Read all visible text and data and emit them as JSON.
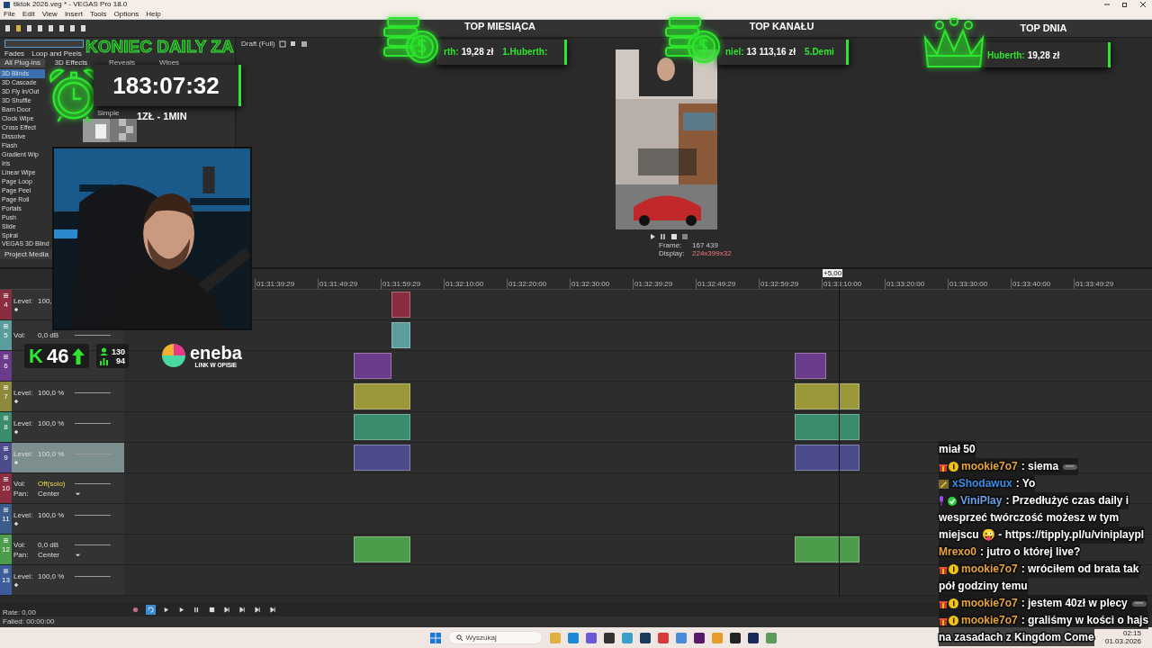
{
  "window": {
    "title": "tiktok 2026.veg * - VEGAS Pro 18.0"
  },
  "menu": [
    "File",
    "Edit",
    "View",
    "Insert",
    "Tools",
    "Options",
    "Help"
  ],
  "preview_toolbar": {
    "quality": "Draft (Full)"
  },
  "transitions": {
    "tabs_row1": [
      {
        "label": "Fades",
        "selected": false
      },
      {
        "label": "Loop and Peels",
        "selected": false
      }
    ],
    "tabs_row2": [
      {
        "label": "All Plug-ins",
        "selected": true
      },
      {
        "label": "3D Effects",
        "selected": false
      },
      {
        "label": "Reveals",
        "selected": false
      },
      {
        "label": "Wipes",
        "selected": false
      }
    ],
    "items": [
      {
        "label": "3D Blinds",
        "selected": true
      },
      {
        "label": "3D Cascade",
        "selected": false
      },
      {
        "label": "3D Fly In/Out",
        "selected": false
      },
      {
        "label": "3D Shuffle",
        "selected": false
      },
      {
        "label": "Barn Door",
        "selected": false
      },
      {
        "label": "Clock Wipe",
        "selected": false
      },
      {
        "label": "Cross Effect",
        "selected": false
      },
      {
        "label": "Dissolve",
        "selected": false
      },
      {
        "label": "Flash",
        "selected": false
      },
      {
        "label": "Gradient Wip",
        "selected": false
      },
      {
        "label": "Iris",
        "selected": false
      },
      {
        "label": "Linear Wipe",
        "selected": false
      },
      {
        "label": "Page Loop",
        "selected": false
      },
      {
        "label": "Page Peel",
        "selected": false
      },
      {
        "label": "Page Roll",
        "selected": false
      },
      {
        "label": "Portals",
        "selected": false
      },
      {
        "label": "Push",
        "selected": false
      },
      {
        "label": "Slide",
        "selected": false
      },
      {
        "label": "Spiral",
        "selected": false
      }
    ],
    "preview_label": "Simple",
    "selection": "VEGAS 3D Blind",
    "media_tab": "Project Media"
  },
  "preview": {
    "frame_label": "Frame:",
    "frame": "167 439",
    "display_label": "Display:",
    "display": "224x399x32"
  },
  "timeline": {
    "marker": "+5,00",
    "ruler": [
      "01:31:39:29",
      "01:31:49:29",
      "01:31:59:29",
      "01:32:10:00",
      "01:32:20:00",
      "01:32:30:00",
      "01:32:39:29",
      "01:32:49:29",
      "01:32:59:29",
      "01:33:10:00",
      "01:33:20:00",
      "01:33:30:00",
      "01:33:40:00",
      "01:33:49:29"
    ],
    "tracks": [
      {
        "number": "4",
        "kind": "video",
        "color": "#8a2d40",
        "selected": false,
        "lines": [
          {
            "label": "Level:",
            "value": "100,"
          }
        ]
      },
      {
        "number": "5",
        "kind": "audio",
        "color": "#5b9c9c",
        "selected": false,
        "lines": [
          {
            "label": "Vol:",
            "value": "0,0 dB",
            "solo": false
          }
        ]
      },
      {
        "number": "6",
        "kind": "video",
        "color": "#6c3c8c",
        "selected": false
      },
      {
        "number": "7",
        "kind": "video",
        "color": "#8c8a3a",
        "selected": false,
        "lines": [
          {
            "label": "Level:",
            "value": "100,0 %"
          }
        ]
      },
      {
        "number": "8",
        "kind": "video",
        "color": "#3a8c6c",
        "selected": false,
        "lines": [
          {
            "label": "Level:",
            "value": "100,0 %"
          }
        ]
      },
      {
        "number": "9",
        "kind": "video",
        "color": "#4c4c8c",
        "selected": true,
        "lines": [
          {
            "label": "Level:",
            "value": "100,0 %"
          }
        ]
      },
      {
        "number": "10",
        "kind": "audio",
        "color": "#8c2d40",
        "selected": false,
        "lines": [
          {
            "label": "Vol:",
            "value": "Off(solo)",
            "solo": true
          },
          {
            "label": "Pan:",
            "value": "Center",
            "solo": false
          }
        ]
      },
      {
        "number": "11",
        "kind": "video",
        "color": "#3c5c8c",
        "selected": false,
        "lines": [
          {
            "label": "Level:",
            "value": "100,0 %"
          }
        ]
      },
      {
        "number": "12",
        "kind": "audio",
        "color": "#4c9c4c",
        "selected": false,
        "lines": [
          {
            "label": "Vol:",
            "value": "0,0 dB",
            "solo": false
          },
          {
            "label": "Pan:",
            "value": "Center",
            "solo": false
          }
        ]
      },
      {
        "number": "13",
        "kind": "video",
        "color": "#3c5c9c",
        "selected": false,
        "lines": [
          {
            "label": "Level:",
            "value": "100,0 %"
          }
        ]
      }
    ]
  },
  "transport": {
    "loop_on": true
  },
  "status": {
    "rate": "Rate: 0,00",
    "failed": "Failed: 00:00:00"
  },
  "taskbar": {
    "search_placeholder": "Wyszukaj",
    "time": "02:15",
    "date": "01.03.2026"
  },
  "overlay": {
    "timer": {
      "title": "KONIEC DAILY ZA",
      "time": "183:07:32",
      "rate": "1ZŁ - 1MIN"
    },
    "leaderboards": [
      {
        "title": "TOP MIESIĄCA",
        "entries": [
          {
            "name": "rth:",
            "amount": "19,28 zł"
          },
          {
            "name": "1.Huberth:"
          }
        ]
      },
      {
        "title": "TOP KANAŁU",
        "entries": [
          {
            "name": "niel:",
            "amount": "13 113,16 zł"
          },
          {
            "name": "5.Demi"
          }
        ]
      },
      {
        "title": "TOP DNIA",
        "entries": [
          {
            "name": "Huberth:",
            "amount": "19,28 zł"
          }
        ]
      }
    ],
    "kick": {
      "logo": "K",
      "followers": "46"
    },
    "viewers": {
      "count_1": "130",
      "count_2": "94"
    },
    "sponsor": {
      "name": "eneba",
      "caption": "LINK W OPISIE"
    },
    "chat": [
      {
        "kind": "continuation",
        "lines": [
          "miał 50"
        ]
      },
      {
        "kind": "subscriber",
        "user": "mookie7o7",
        "color": "#e8a33a",
        "lines": [
          ": siema"
        ],
        "emote": true
      },
      {
        "kind": "editor",
        "user": "xShodawux",
        "color": "#3a8ee8",
        "lines": [
          ": Yo"
        ],
        "emote": false
      },
      {
        "kind": "streamer",
        "user": "ViniPlay",
        "color": "#6aa0e8",
        "lines": [
          ": Przedłużyć czas daily i",
          "wesprzeć twórczość możesz w tym",
          "miejscu 😜 - https://tipply.pl/u/viniplaypl"
        ],
        "emote": false
      },
      {
        "kind": "viewer",
        "user": "Mrexo0",
        "color": "#e8a33a",
        "lines": [
          ": jutro o której live?"
        ],
        "emote": false
      },
      {
        "kind": "subscriber",
        "user": "mookie7o7",
        "color": "#e8a33a",
        "lines": [
          ": wróciłem od brata tak",
          "pół godziny temu"
        ],
        "emote": false
      },
      {
        "kind": "subscriber",
        "user": "mookie7o7",
        "color": "#e8a33a",
        "lines": [
          ": jestem 40zł w plecy"
        ],
        "emote": true
      },
      {
        "kind": "subscriber",
        "user": "mookie7o7",
        "color": "#e8a33a",
        "lines": [
          ": graliśmy w kości o hajs",
          "na zasadach z Kingdom Come"
        ],
        "emote": false
      }
    ]
  }
}
